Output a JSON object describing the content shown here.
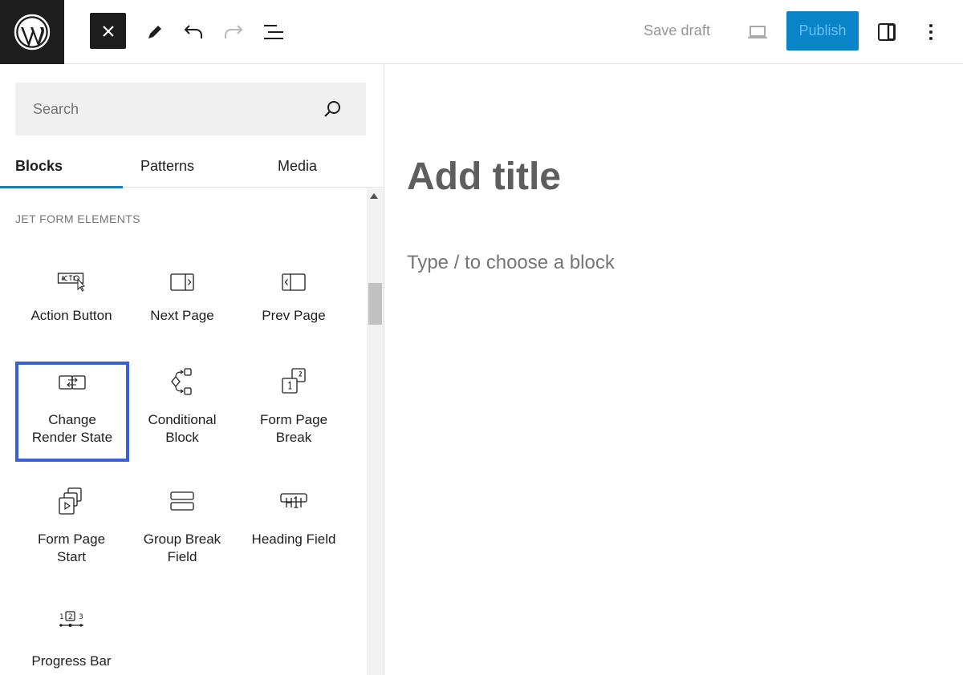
{
  "toolbar": {
    "logo_icon": "wordpress-logo",
    "close_icon": "close-icon",
    "tools_icon": "pencil-icon",
    "undo_icon": "undo-icon",
    "redo_icon": "redo-icon",
    "list_view_icon": "list-view-icon",
    "save_draft_label": "Save draft",
    "preview_icon": "laptop-icon",
    "publish_label": "Publish",
    "settings_icon": "sidebar-toggle-icon",
    "options_icon": "more-vertical-icon",
    "publish_color": "#0a84c8"
  },
  "inserter": {
    "search": {
      "placeholder": "Search",
      "value": ""
    },
    "tabs": [
      {
        "label": "Blocks",
        "active": true
      },
      {
        "label": "Patterns",
        "active": false
      },
      {
        "label": "Media",
        "active": false
      }
    ],
    "category": "JET FORM ELEMENTS",
    "blocks": [
      {
        "label": "Action Button",
        "icon": "action-button-icon"
      },
      {
        "label": "Next Page",
        "icon": "next-page-icon"
      },
      {
        "label": "Prev Page",
        "icon": "prev-page-icon"
      },
      {
        "label": "Change Render State",
        "line1": "Change",
        "line2": "Render State",
        "icon": "change-render-state-icon",
        "selected": true
      },
      {
        "label": "Conditional Block",
        "line1": "Conditional",
        "line2": "Block",
        "icon": "conditional-block-icon"
      },
      {
        "label": "Form Page Break",
        "line1": "Form Page",
        "line2": "Break",
        "icon": "form-page-break-icon"
      },
      {
        "label": "Form Page Start",
        "line1": "Form Page",
        "line2": "Start",
        "icon": "form-page-start-icon"
      },
      {
        "label": "Group Break Field",
        "line1": "Group Break",
        "line2": "Field",
        "icon": "group-break-icon"
      },
      {
        "label": "Heading Field",
        "icon": "heading-field-icon"
      },
      {
        "label": "Progress Bar",
        "icon": "progress-bar-icon"
      }
    ],
    "selection_color": "#3a5fd9"
  },
  "editor": {
    "title_placeholder": "Add title",
    "block_placeholder": "Type / to choose a block"
  }
}
